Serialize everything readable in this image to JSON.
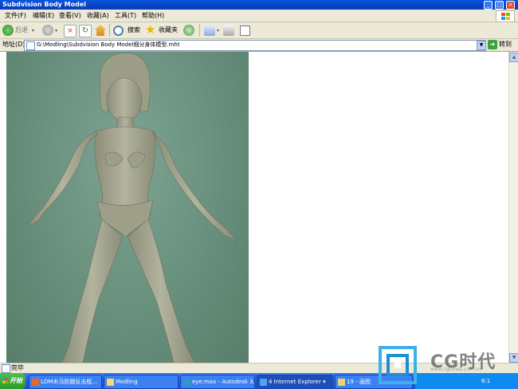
{
  "window": {
    "title": "Subdvision Body Model"
  },
  "menu": [
    "文件(F)",
    "编辑(E)",
    "查看(V)",
    "收藏(A)",
    "工具(T)",
    "帮助(H)"
  ],
  "toolbar": {
    "back": "后退",
    "search": "搜索",
    "favorites": "收藏夹"
  },
  "address": {
    "label": "地址(D)",
    "value": "G:\\Modling\\Subdvision Body Model细分身体模型.mht",
    "go": "转到"
  },
  "status": {
    "text": "完毕"
  },
  "taskbar": {
    "start": "开始",
    "tasks": [
      "LDM木马防御反击程...",
      "Modling",
      "eye.max - Autodesk 3...",
      "4 Internet Explorer",
      "19 - 画图"
    ],
    "clock": "6:1"
  },
  "watermark": {
    "brand": "CG时代",
    "url": "www.cgtimes.com.cn"
  },
  "colors": {
    "titlebar": "#0842c4",
    "taskbar": "#245edc",
    "render_bg": "#6b9380",
    "figure": "#a7a893"
  },
  "icons": [
    "back-arrow-icon",
    "forward-arrow-icon",
    "stop-icon",
    "refresh-icon",
    "home-icon",
    "search-icon",
    "favorites-star-icon",
    "media-icon",
    "mail-icon",
    "print-icon",
    "edit-icon",
    "page-icon",
    "go-arrow-icon"
  ]
}
